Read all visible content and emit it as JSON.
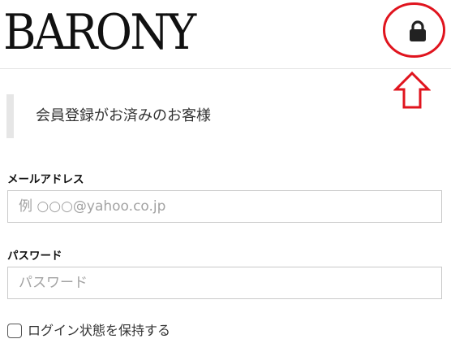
{
  "header": {
    "logo_text": "BARONY",
    "lock_icon": "lock-icon",
    "annotation_color": "#e0141e"
  },
  "login_section": {
    "title": "会員登録がお済みのお客様"
  },
  "form": {
    "email": {
      "label": "メールアドレス",
      "placeholder": "例 ○○○@yahoo.co.jp",
      "value": ""
    },
    "password": {
      "label": "パスワード",
      "placeholder": "パスワード",
      "value": ""
    },
    "remember": {
      "label": "ログイン状態を保持する",
      "checked": false
    }
  }
}
